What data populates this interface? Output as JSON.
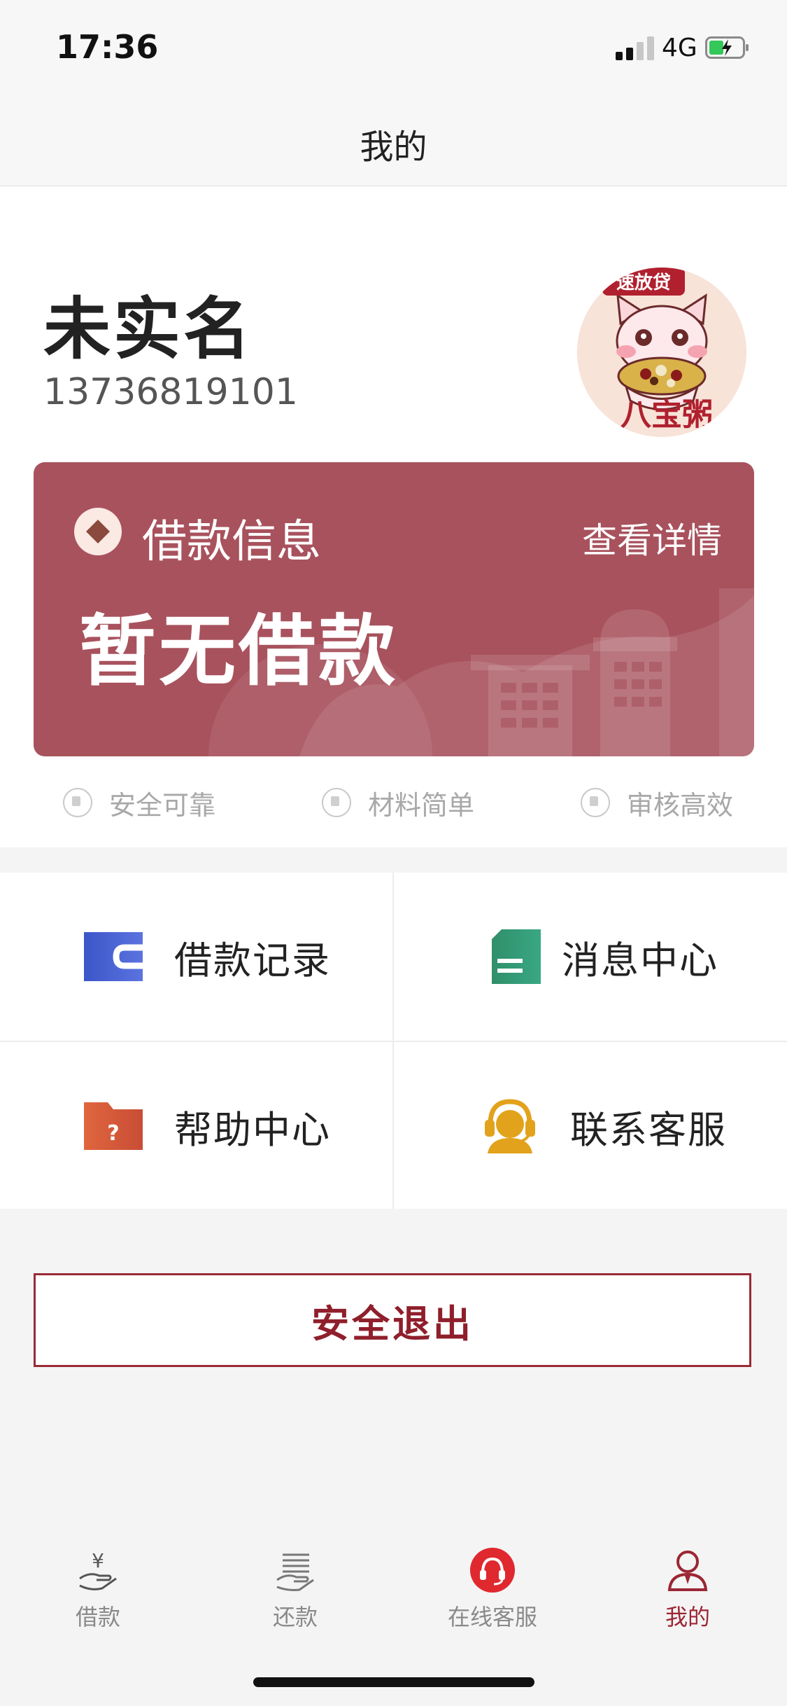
{
  "status_bar": {
    "time": "17:36",
    "network": "4G"
  },
  "nav": {
    "title": "我的"
  },
  "profile": {
    "name": "未实名",
    "phone": "13736819101",
    "avatar_badge": "速放贷",
    "avatar_text": "八宝粥"
  },
  "loan_card": {
    "title": "借款信息",
    "detail_link": "查看详情",
    "status": "暂无借款"
  },
  "features": [
    {
      "icon": "shield-icon",
      "label": "安全可靠"
    },
    {
      "icon": "document-icon",
      "label": "材料简单"
    },
    {
      "icon": "lightning-icon",
      "label": "审核高效"
    }
  ],
  "menu": [
    {
      "icon": "loan-record-icon",
      "label": "借款记录"
    },
    {
      "icon": "message-icon",
      "label": "消息中心"
    },
    {
      "icon": "help-folder-icon",
      "label": "帮助中心"
    },
    {
      "icon": "customer-service-icon",
      "label": "联系客服"
    }
  ],
  "logout_label": "安全退出",
  "tabs": [
    {
      "icon": "borrow-icon",
      "label": "借款"
    },
    {
      "icon": "repay-icon",
      "label": "还款"
    },
    {
      "icon": "headset-icon",
      "label": "在线客服"
    },
    {
      "icon": "profile-icon",
      "label": "我的"
    }
  ],
  "colors": {
    "accent": "#a8525d",
    "tab_active": "#9b2634",
    "logout": "#8f1f2b"
  }
}
